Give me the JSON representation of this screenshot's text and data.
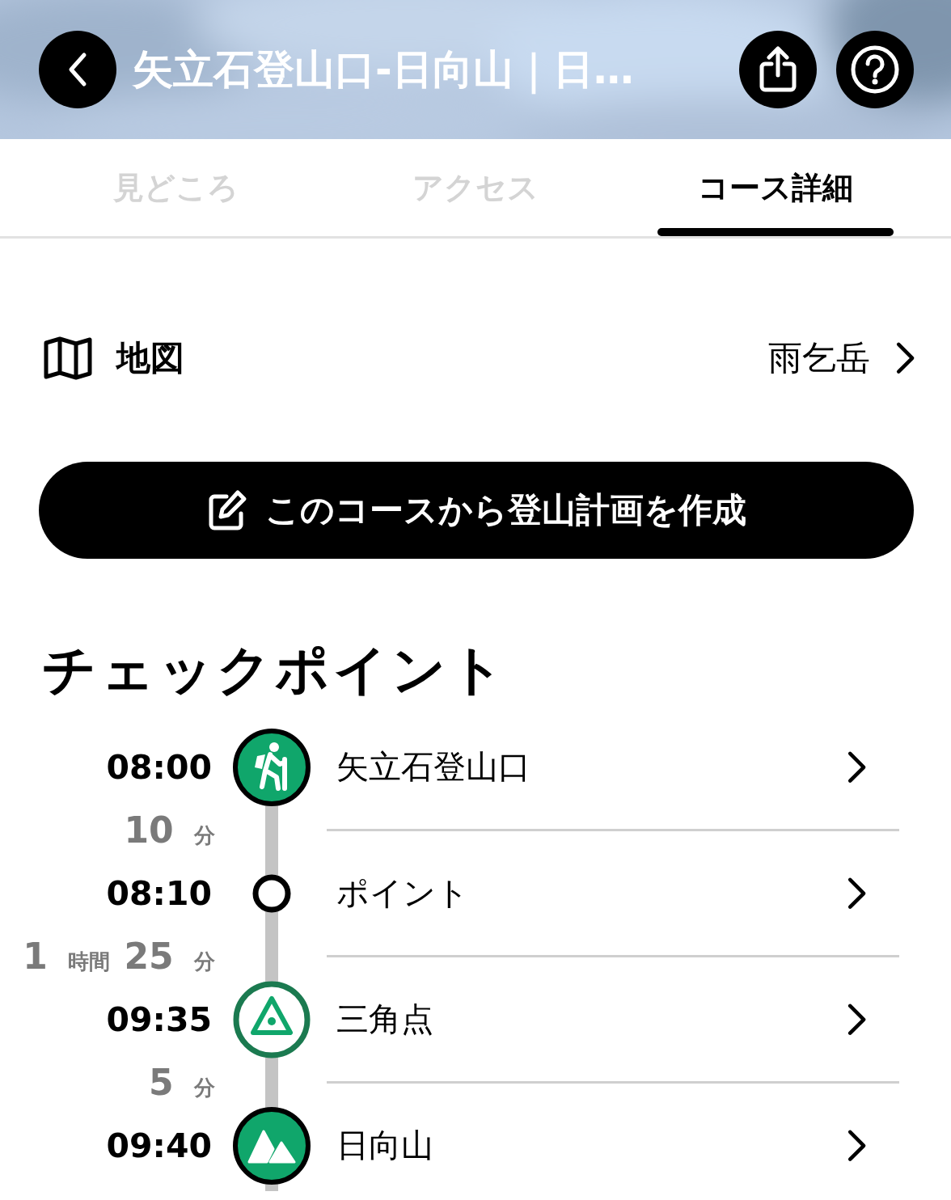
{
  "header": {
    "title": "矢立石登山口-日向山｜日…"
  },
  "tabs": [
    {
      "label": "見どころ",
      "selected": false
    },
    {
      "label": "アクセス",
      "selected": false
    },
    {
      "label": "コース詳細",
      "selected": true
    }
  ],
  "map_row": {
    "label": "地図",
    "value": "雨乞岳"
  },
  "plan_button": {
    "label": "このコースから登山計画を作成"
  },
  "checkpoints": {
    "title": "チェックポイント",
    "items": [
      {
        "time": "08:00",
        "name": "矢立石登山口",
        "kind": "start",
        "duration": [
          {
            "value": "10",
            "unit": "分"
          }
        ]
      },
      {
        "time": "08:10",
        "name": "ポイント",
        "kind": "point",
        "duration": [
          {
            "value": "1",
            "unit": "時間"
          },
          {
            "value": "25",
            "unit": "分"
          }
        ]
      },
      {
        "time": "09:35",
        "name": "三角点",
        "kind": "triangulation",
        "duration": [
          {
            "value": "5",
            "unit": "分"
          }
        ]
      },
      {
        "time": "09:40",
        "name": "日向山",
        "kind": "summit"
      }
    ]
  }
}
